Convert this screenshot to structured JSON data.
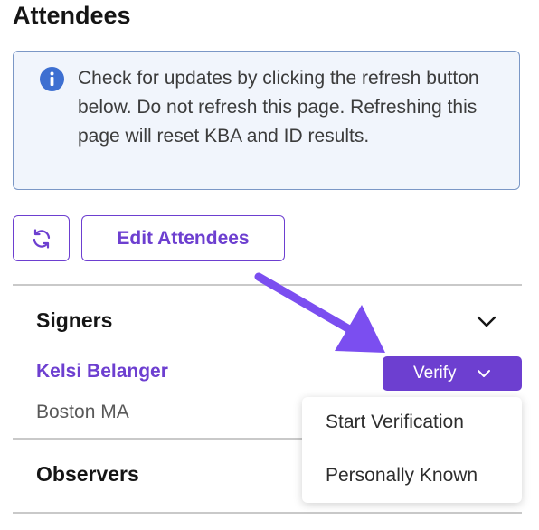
{
  "page": {
    "title": "Attendees"
  },
  "info": {
    "icon": "info-icon",
    "message": "Check for updates by clicking the refresh button below. Do not refresh this page. Refreshing this page will reset KBA and ID results."
  },
  "toolbar": {
    "refresh_icon": "refresh-icon",
    "edit_label": "Edit Attendees"
  },
  "signers": {
    "title": "Signers",
    "items": [
      {
        "name": "Kelsi Belanger",
        "location": "Boston MA",
        "action_label": "Verify"
      }
    ]
  },
  "verify_menu": {
    "items": [
      {
        "label": "Start Verification"
      },
      {
        "label": "Personally Known"
      }
    ]
  },
  "observers": {
    "title": "Observers"
  },
  "colors": {
    "accent": "#6d3fd0",
    "info_bg": "#f1f5fc",
    "info_border": "#7b97c6",
    "info_icon": "#3d6fd1",
    "annotation_arrow": "#7b4ef0"
  }
}
